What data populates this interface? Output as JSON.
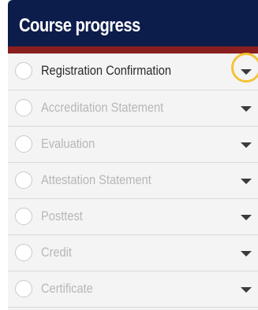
{
  "panel": {
    "title": "Course progress"
  },
  "items": [
    {
      "label": "Registration Confirmation",
      "state": "active",
      "icon": "chevron-down-icon"
    },
    {
      "label": "Accreditation Statement",
      "state": "disabled",
      "icon": "chevron-down-icon"
    },
    {
      "label": "Evaluation",
      "state": "disabled",
      "icon": "chevron-down-icon"
    },
    {
      "label": "Attestation Statement",
      "state": "disabled",
      "icon": "chevron-down-icon"
    },
    {
      "label": "Posttest",
      "state": "disabled",
      "icon": "chevron-down-icon"
    },
    {
      "label": "Credit",
      "state": "disabled",
      "icon": "chevron-down-icon"
    },
    {
      "label": "Certificate",
      "state": "disabled",
      "icon": "chevron-down-icon"
    }
  ],
  "colors": {
    "header_bg": "#0c1c4b",
    "accent_bar": "#8a1f1f",
    "highlight_ring": "#f3c433"
  }
}
